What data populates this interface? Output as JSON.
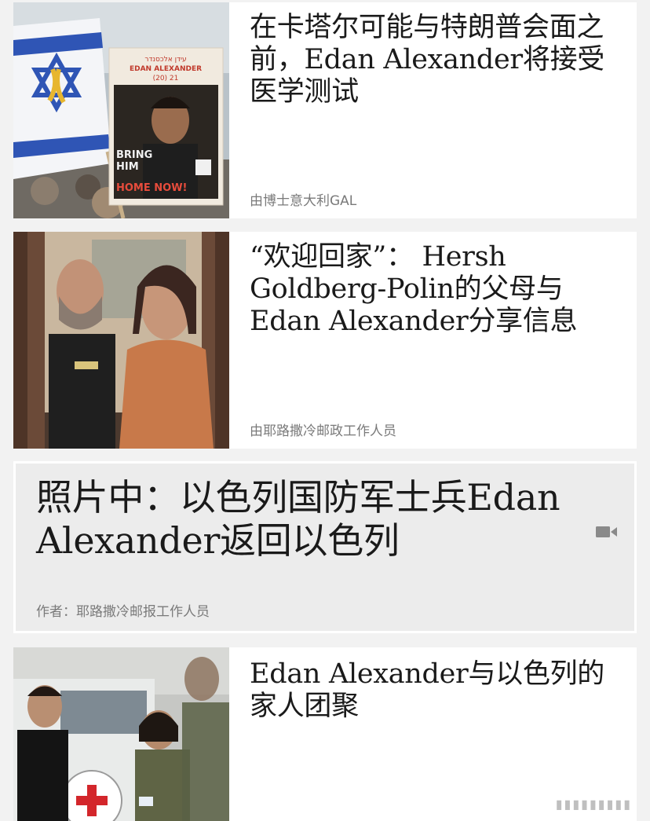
{
  "articles": [
    {
      "headline": "在卡塔尔可能与特朗普会面之前，Edan Alexander将接受医学测试",
      "byline": "由博士意大利GAL",
      "image_alt": "Israeli flag and a protest sign with Edan Alexander's portrait reading BRING HIM HOME NOW!",
      "sign_text": {
        "top_hebrew": "עידן אלכסנדר",
        "name": "EDAN ALEXANDER",
        "age": "(20) 21",
        "bring": "BRING",
        "him": "HIM",
        "home_now": "HOME NOW!"
      }
    },
    {
      "headline": "“欢迎回家”： Hersh Goldberg-Polin的父母与Edan Alexander分享信息",
      "byline": "由耶路撒冷邮政工作人员",
      "image_alt": "A man and a woman in a video call selfie"
    },
    {
      "headline": "照片中：以色列国防军士兵Edan Alexander返回以色列",
      "byline": "作者：耶路撒冷邮报工作人员",
      "has_video": true,
      "icon": "video-camera-icon"
    },
    {
      "headline": "Edan Alexander与以色列的家人团聚",
      "byline": "",
      "image_alt": "Edan Alexander meeting a female soldier beside a Red Cross vehicle"
    }
  ]
}
